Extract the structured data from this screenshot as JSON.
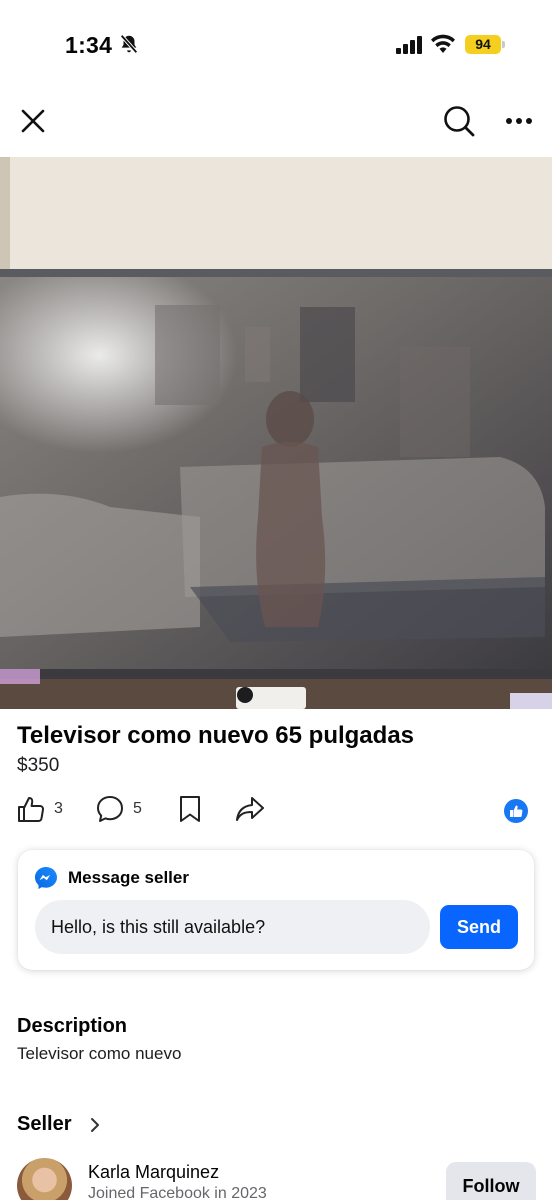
{
  "status_bar": {
    "time": "1:34",
    "battery": "94",
    "icons": [
      "bell-slash-icon",
      "signal-icon",
      "wifi-icon"
    ]
  },
  "nav": {
    "icons": [
      "close-icon",
      "search-icon",
      "more-icon"
    ]
  },
  "listing": {
    "title": "Televisor como nuevo 65 pulgadas",
    "price": "$350",
    "photo_subject": "tv-photo"
  },
  "actions": {
    "like_count": "3",
    "comment_count": "5",
    "icons": [
      "thumbs-up-icon",
      "comment-icon",
      "bookmark-icon",
      "share-icon",
      "like-reaction-icon"
    ]
  },
  "message": {
    "title": "Message seller",
    "input_value": "Hello, is this still available?",
    "send_label": "Send"
  },
  "description": {
    "heading": "Description",
    "text": "Televisor como nuevo"
  },
  "seller": {
    "heading": "Seller",
    "name": "Karla Marquinez",
    "joined": "Joined Facebook in 2023",
    "follow_label": "Follow"
  },
  "colors": {
    "accent": "#0866ff",
    "battery": "#f5cf1f",
    "muted_text": "#65676b"
  }
}
